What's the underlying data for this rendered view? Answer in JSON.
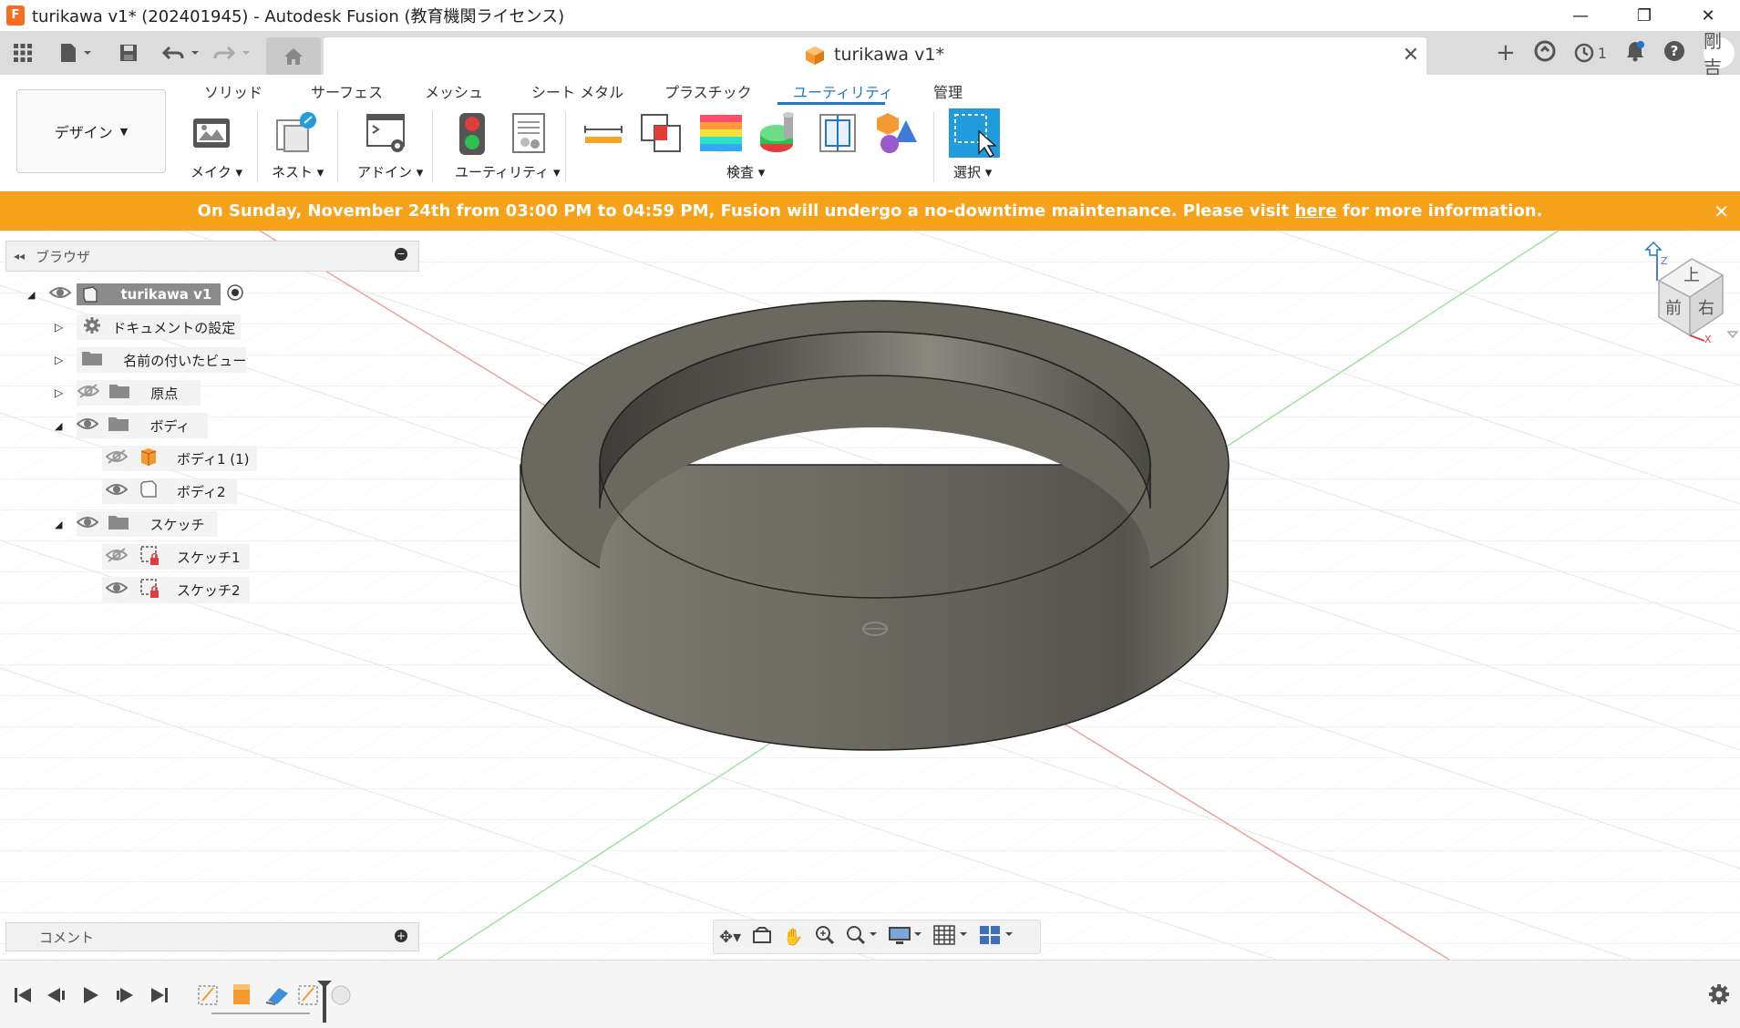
{
  "window": {
    "title": "turikawa v1* (202401945) - Autodesk Fusion (教育機関ライセンス)",
    "minimize": "—",
    "restore": "❐",
    "close": "✕"
  },
  "tabbar": {
    "doc_tab_title": "turikawa v1*",
    "doc_tab_close": "✕",
    "jobs_count": "1",
    "user_name": "剛吉"
  },
  "ribbon": {
    "workspace_label": "デザイン",
    "tabs": [
      {
        "label": "ソリッド",
        "active": false
      },
      {
        "label": "サーフェス",
        "active": false
      },
      {
        "label": "メッシュ",
        "active": false
      },
      {
        "label": "シート メタル",
        "active": false
      },
      {
        "label": "プラスチック",
        "active": false
      },
      {
        "label": "ユーティリティ",
        "active": true
      },
      {
        "label": "管理",
        "active": false
      }
    ],
    "groups": {
      "make": "メイク",
      "nest": "ネスト",
      "addins": "アドイン",
      "utility": "ユーティリティ",
      "inspect": "検査",
      "select": "選択"
    }
  },
  "banner": {
    "text_before": "On Sunday, November 24th from 03:00 PM to 04:59 PM, Fusion will undergo a no-downtime maintenance. Please visit ",
    "link": "here",
    "text_after": " for more information.",
    "color": "#f7a21b"
  },
  "browser": {
    "title": "ブラウザ",
    "root": "turikawa v1",
    "items": [
      {
        "label": "ドキュメントの設定"
      },
      {
        "label": "名前の付いたビュー"
      },
      {
        "label": "原点"
      },
      {
        "label": "ボディ"
      },
      {
        "label": "ボディ1 (1)"
      },
      {
        "label": "ボディ2"
      },
      {
        "label": "スケッチ"
      },
      {
        "label": "スケッチ1"
      },
      {
        "label": "スケッチ2"
      }
    ]
  },
  "comment": {
    "label": "コメント"
  },
  "viewcube": {
    "top": "上",
    "front": "前",
    "right": "右",
    "z": "Z",
    "x": "X"
  },
  "colors": {
    "accent": "#1f77c9",
    "ring": "#6b6860",
    "red_axis": "#e06060",
    "green_axis": "#6cd46c"
  }
}
